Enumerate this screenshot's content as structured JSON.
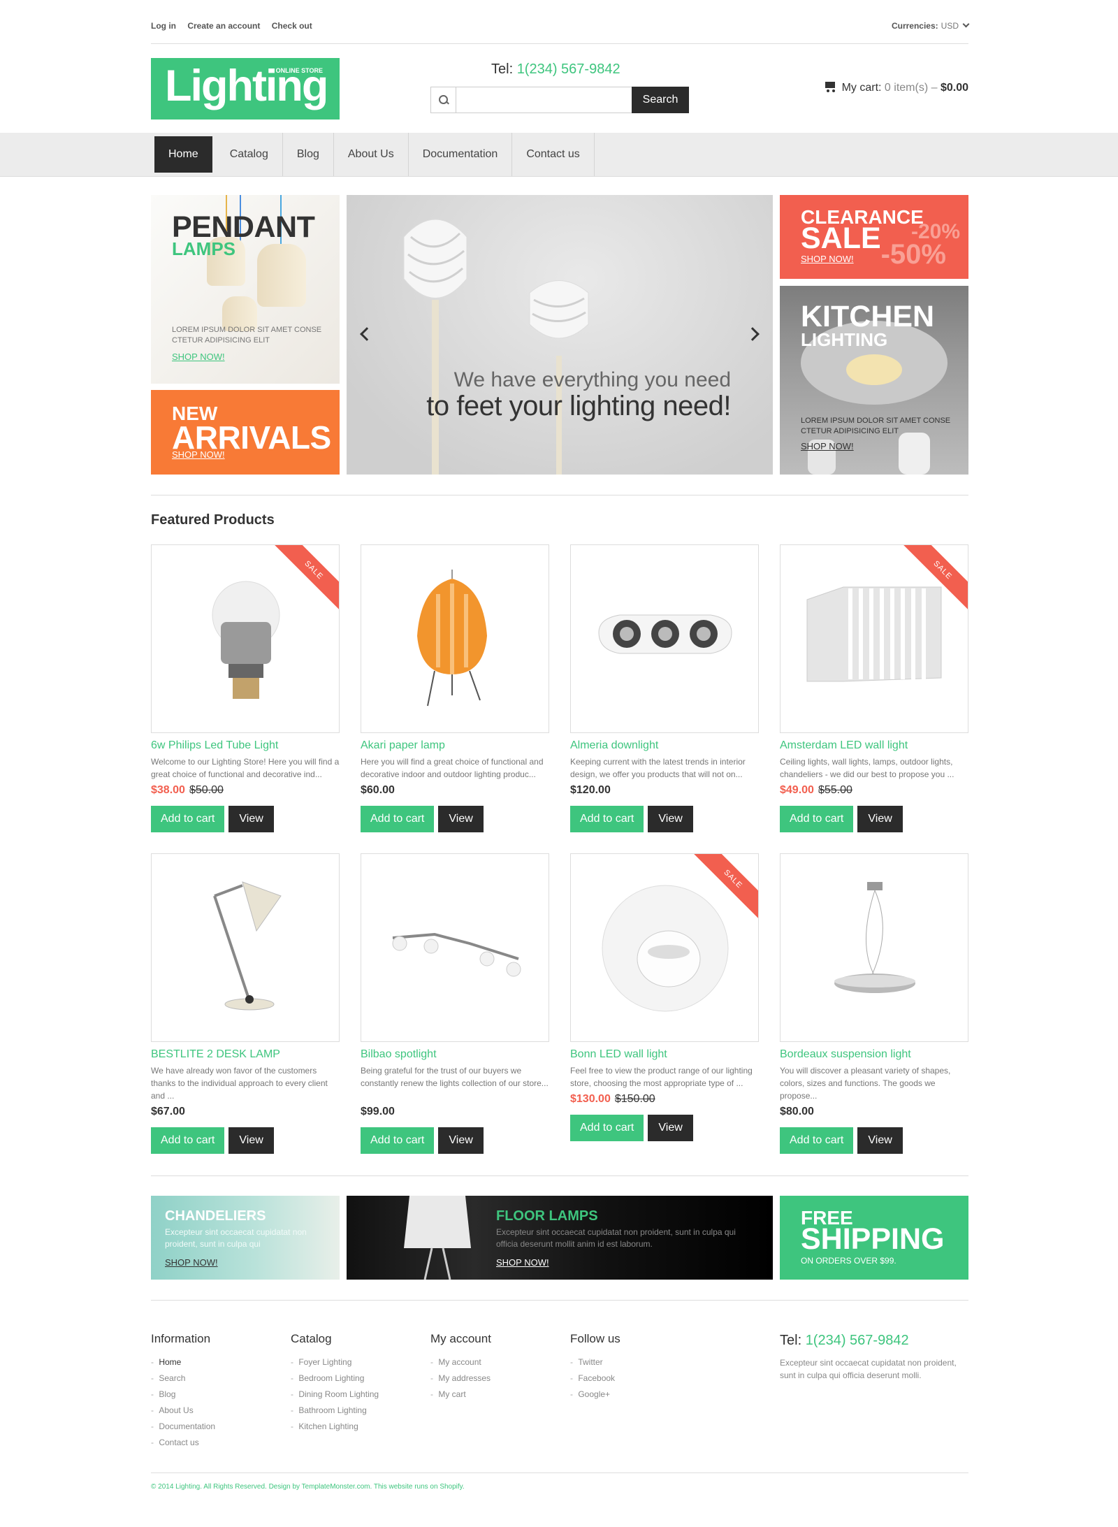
{
  "topbar": {
    "links": [
      "Log in",
      "Create an account",
      "Check out"
    ],
    "currency_label": "Currencies:",
    "currency_value": "USD"
  },
  "header": {
    "logo_text": "Lighting",
    "logo_sub": "ONLINE STORE",
    "tel_label": "Tel:",
    "tel_number": "1(234) 567-9842",
    "search_placeholder": "",
    "search_button": "Search",
    "cart_label": "My cart:",
    "cart_items": "0 item(s)",
    "cart_sep": " – ",
    "cart_total": "$0.00"
  },
  "nav": [
    "Home",
    "Catalog",
    "Blog",
    "About Us",
    "Documentation",
    "Contact us"
  ],
  "banners": {
    "pendant": {
      "title": "PENDANT",
      "subtitle": "LAMPS",
      "text": "LOREM IPSUM DOLOR SIT AMET CONSE CTETUR ADIPISICING ELIT",
      "link": "SHOP NOW!"
    },
    "arrivals": {
      "line1": "NEW",
      "line2": "ARRIVALS",
      "link": "SHOP NOW!"
    },
    "slider": {
      "line1": "We have everything you need",
      "line2": "to feet your lighting need!"
    },
    "clearance": {
      "line1": "CLEARANCE",
      "line2": "SALE",
      "pct1": "-20%",
      "pct2": "-50%",
      "link": "SHOP NOW!"
    },
    "kitchen": {
      "line1": "KITCHEN",
      "line2": "LIGHTING",
      "text": "LOREM IPSUM DOLOR SIT AMET CONSE CTETUR ADIPISICING ELIT",
      "link": "SHOP NOW!"
    }
  },
  "featured": {
    "title": "Featured Products",
    "add_label": "Add to cart",
    "view_label": "View",
    "sale_label": "SALE",
    "products": [
      {
        "name": "6w Philips Led Tube Light",
        "desc": "Welcome to our Lighting Store! Here you will find a great choice of functional and decorative ind...",
        "price": "$38.00",
        "old": "$50.00",
        "sale": true
      },
      {
        "name": "Akari paper lamp",
        "desc": "Here you will find a great choice of functional and decorative indoor and outdoor lighting produc...",
        "price": "$60.00",
        "old": "",
        "sale": false
      },
      {
        "name": "Almeria downlight",
        "desc": "Keeping current with the latest trends in interior design, we offer you products that will not on...",
        "price": "$120.00",
        "old": "",
        "sale": false
      },
      {
        "name": "Amsterdam LED wall light",
        "desc": "Ceiling lights, wall lights, lamps, outdoor lights, chandeliers - we did our best to propose you ...",
        "price": "$49.00",
        "old": "$55.00",
        "sale": true
      },
      {
        "name": "BESTLITE 2 DESK LAMP",
        "desc": "We have already won favor of the customers thanks to the individual approach to every client and ...",
        "price": "$67.00",
        "old": "",
        "sale": false
      },
      {
        "name": "Bilbao spotlight",
        "desc": "Being grateful for the trust of our buyers we constantly renew the lights collection of our store...",
        "price": "$99.00",
        "old": "",
        "sale": false
      },
      {
        "name": "Bonn LED wall light",
        "desc": "Feel free to view the product range of our lighting store, choosing the most appropriate type of ...",
        "price": "$130.00",
        "old": "$150.00",
        "sale": true
      },
      {
        "name": "Bordeaux suspension light",
        "desc": "You will discover a pleasant variety of shapes, colors, sizes and functions. The goods we propose...",
        "price": "$80.00",
        "old": "",
        "sale": false
      }
    ]
  },
  "bottom_banners": {
    "chandeliers": {
      "title": "CHANDELIERS",
      "text": "Excepteur sint occaecat cupidatat non proident, sunt in culpa qui",
      "link": "SHOP NOW!"
    },
    "floor": {
      "title": "FLOOR LAMPS",
      "text": "Excepteur sint occaecat cupidatat non proident, sunt in culpa qui officia deserunt mollit anim id est laborum.",
      "link": "SHOP NOW!"
    },
    "shipping": {
      "line1": "FREE",
      "line2": "SHIPPING",
      "line3": "ON ORDERS OVER $99."
    }
  },
  "footer": {
    "information": {
      "title": "Information",
      "items": [
        "Home",
        "Search",
        "Blog",
        "About Us",
        "Documentation",
        "Contact us"
      ]
    },
    "catalog": {
      "title": "Catalog",
      "items": [
        "Foyer Lighting",
        "Bedroom Lighting",
        "Dining Room Lighting",
        "Bathroom Lighting",
        "Kitchen Lighting"
      ]
    },
    "account": {
      "title": "My account",
      "items": [
        "My account",
        "My addresses",
        "My cart"
      ]
    },
    "follow": {
      "title": "Follow us",
      "items": [
        "Twitter",
        "Facebook",
        "Google+"
      ]
    },
    "tel_label": "Tel:",
    "tel_number": "1(234) 567-9842",
    "desc": "Excepteur sint occaecat cupidatat non proident, sunt in culpa qui officia deserunt molli.",
    "copyright": "© 2014 Lighting. All Rights Reserved. Design by TemplateMonster.com. This website runs on Shopify."
  },
  "colors": {
    "accent": "#3ec57e",
    "sale": "#f25f4f",
    "orange": "#f87a36",
    "dark": "#2b2b2b"
  }
}
